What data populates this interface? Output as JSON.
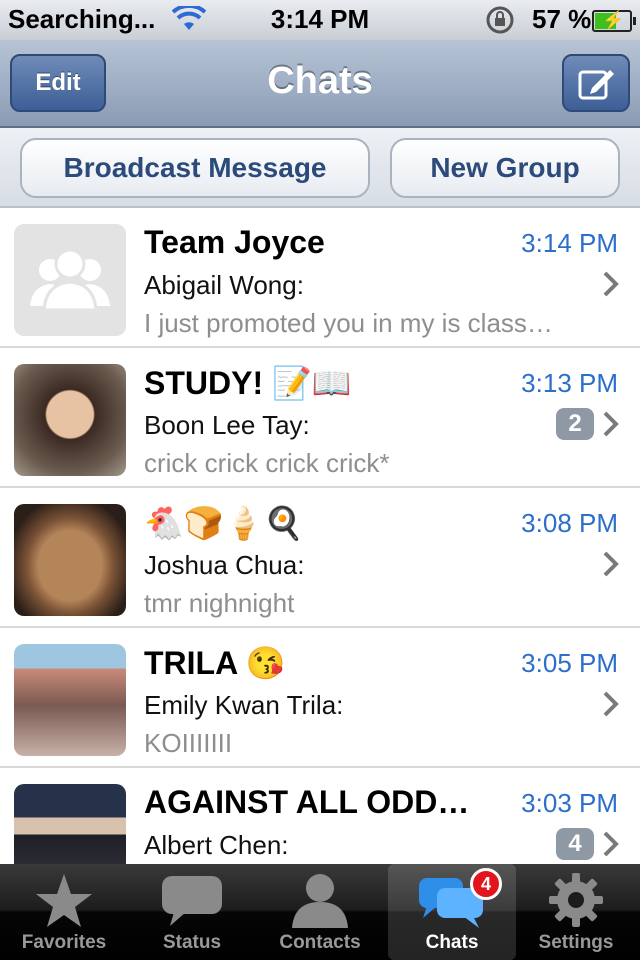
{
  "status_bar": {
    "carrier": "Searching...",
    "time": "3:14 PM",
    "battery_percent": "57 %",
    "battery_level": 0.57
  },
  "nav": {
    "edit_label": "Edit",
    "title": "Chats",
    "compose_icon": "compose-icon"
  },
  "actions": {
    "broadcast_label": "Broadcast Message",
    "new_group_label": "New Group"
  },
  "chats": [
    {
      "name": "Team Joyce",
      "time": "3:14 PM",
      "sender": "Abigail Wong:",
      "preview": "I just promoted you in my is class…",
      "unread": ""
    },
    {
      "name": "STUDY! 📝📖",
      "time": "3:13 PM",
      "sender": "Boon Lee Tay:",
      "preview": "crick crick crick crick*",
      "unread": "2"
    },
    {
      "name": "🐔🍞🍦🍳",
      "time": "3:08 PM",
      "sender": "Joshua Chua:",
      "preview": "tmr nighnight",
      "unread": ""
    },
    {
      "name": "TRILA 😘",
      "time": "3:05 PM",
      "sender": "Emily Kwan Trila:",
      "preview": "KOIIIIIII",
      "unread": ""
    },
    {
      "name": "AGAINST ALL ODD…",
      "time": "3:03 PM",
      "sender": "Albert Chen:",
      "preview": "",
      "unread": "4"
    }
  ],
  "tabs": [
    {
      "label": "Favorites",
      "icon": "star-icon"
    },
    {
      "label": "Status",
      "icon": "speech-bubble-icon"
    },
    {
      "label": "Contacts",
      "icon": "person-icon"
    },
    {
      "label": "Chats",
      "icon": "chat-bubbles-icon",
      "badge": "4"
    },
    {
      "label": "Settings",
      "icon": "gear-icon"
    }
  ],
  "colors": {
    "accent": "#2c6fcb",
    "nav_bar": "#8a9bb4",
    "badge_red": "#e2141c"
  }
}
